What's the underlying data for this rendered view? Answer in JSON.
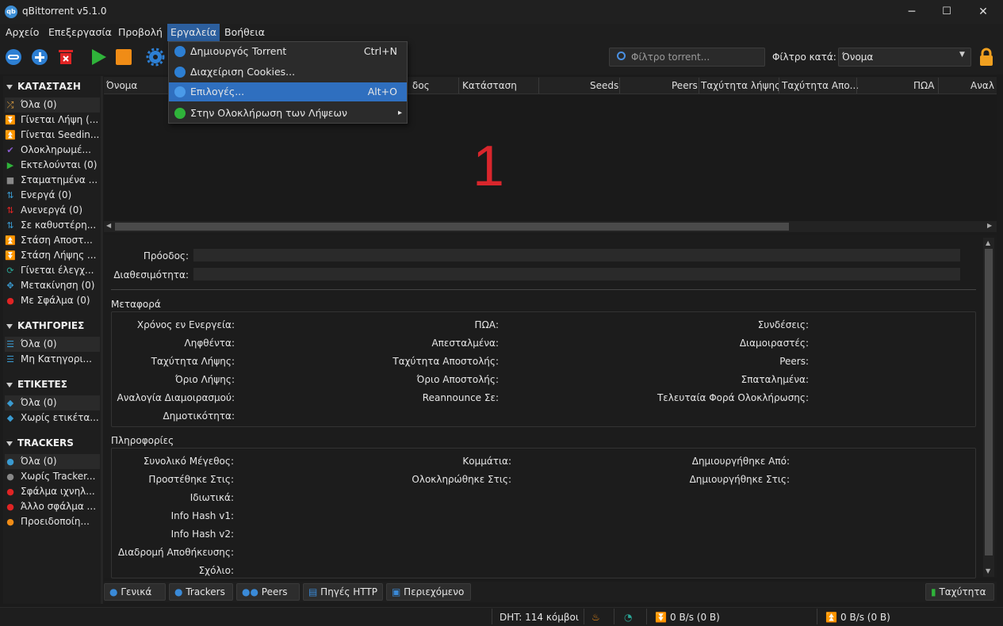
{
  "window": {
    "title": "qBittorrent v5.1.0",
    "icon_text": "qb",
    "minimize": "─",
    "maximize": "☐",
    "close": "✕"
  },
  "menubar": {
    "items": [
      "Αρχείο",
      "Επεξεργασία",
      "Προβολή",
      "Εργαλεία",
      "Βοήθεια"
    ]
  },
  "tools_menu": {
    "items": [
      {
        "label": "Δημιουργός Torrent",
        "shortcut": "Ctrl+N",
        "icon": "create-torrent-icon"
      },
      {
        "label": "Διαχείριση Cookies...",
        "shortcut": "",
        "icon": "cookie-icon"
      },
      {
        "label": "Επιλογές...",
        "shortcut": "Alt+O",
        "icon": "gear-icon"
      },
      {
        "label": "Στην  Ολοκλήρωση των Λήψεων",
        "shortcut": "",
        "icon": "check-icon",
        "submenu_arrow": "▸"
      }
    ]
  },
  "toolbar": {
    "search_placeholder": "Φίλτρο torrent...",
    "filter_label": "Φίλτρο κατά:",
    "filter_value": "Όνομα"
  },
  "sidebar": {
    "status_header": "ΚΑΤΑΣΤΑΣΗ",
    "status_items": [
      "Όλα (0)",
      "Γίνεται Λήψη (...",
      "Γίνεται Seedin...",
      "Ολοκληρωμέ...",
      "Εκτελούνται (0)",
      "Σταματημένα ...",
      "Ενεργά (0)",
      "Ανενεργά (0)",
      "Σε καθυστέρη...",
      "Στάση Αποστ...",
      "Στάση Λήψης ...",
      "Γίνεται έλεγχ...",
      "Μετακίνηση (0)",
      "Με Σφάλμα (0)"
    ],
    "categories_header": "ΚΑΤΗΓΟΡΙΕΣ",
    "categories_items": [
      "Όλα (0)",
      "Μη Κατηγορι..."
    ],
    "tags_header": "ΕΤΙΚΕΤΕΣ",
    "tags_items": [
      "Όλα (0)",
      "Χωρίς ετικέτα..."
    ],
    "trackers_header": "TRACKERS",
    "trackers_items": [
      "Όλα (0)",
      "Χωρίς Tracker...",
      "Σφάλμα ιχνηλ...",
      "Άλλο σφάλμα ...",
      "Προειδοποίη..."
    ]
  },
  "columns": [
    "Όνομα",
    "δος",
    "Κατάσταση",
    "Seeds",
    "Peers",
    "Ταχύτητα λήψης",
    "Ταχύτητα Απο...",
    "ΠΩΑ",
    "Αναλ"
  ],
  "overlay_number": "1",
  "details": {
    "progress_label": "Πρόοδος:",
    "availability_label": "Διαθεσιμότητα:",
    "transfer_header": "Μεταφορά",
    "transfer_col1": [
      "Χρόνος εν Ενεργεία:",
      "Ληφθέντα:",
      "Ταχύτητα Λήψης:",
      "Όριο Λήψης:",
      "Αναλογία Διαμοιρασμού:",
      "Δημοτικότητα:"
    ],
    "transfer_col2": [
      "ΠΩΑ:",
      "Απεσταλμένα:",
      "Ταχύτητα Αποστολής:",
      "Όριο Αποστολής:",
      "Reannounce Σε:"
    ],
    "transfer_col3": [
      "Συνδέσεις:",
      "Διαμοιραστές:",
      "Peers:",
      "Σπαταλημένα:",
      "Τελευταία Φορά Ολοκλήρωσης:"
    ],
    "info_header": "Πληροφορίες",
    "info_col1": [
      "Συνολικό Μέγεθος:",
      "Προστέθηκε Στις:",
      "Ιδιωτικά:",
      "Info Hash v1:",
      "Info Hash v2:",
      "Διαδρομή Αποθήκευσης:",
      "Σχόλιο:"
    ],
    "info_col2": [
      "Κομμάτια:",
      "Ολοκληρώθηκε Στις:"
    ],
    "info_col3": [
      "Δημιουργήθηκε Από:",
      "Δημιουργήθηκε Στις:"
    ]
  },
  "bottom_tabs": [
    "Γενικά",
    "Trackers",
    "Peers",
    "Πηγές HTTP",
    "Περιεχόμενο"
  ],
  "speed_button": "Ταχύτητα",
  "statusbar": {
    "dht": "DHT: 114 κόμβοι",
    "download": "0 B/s (0 B)",
    "upload": "0 B/s (0 B)"
  }
}
